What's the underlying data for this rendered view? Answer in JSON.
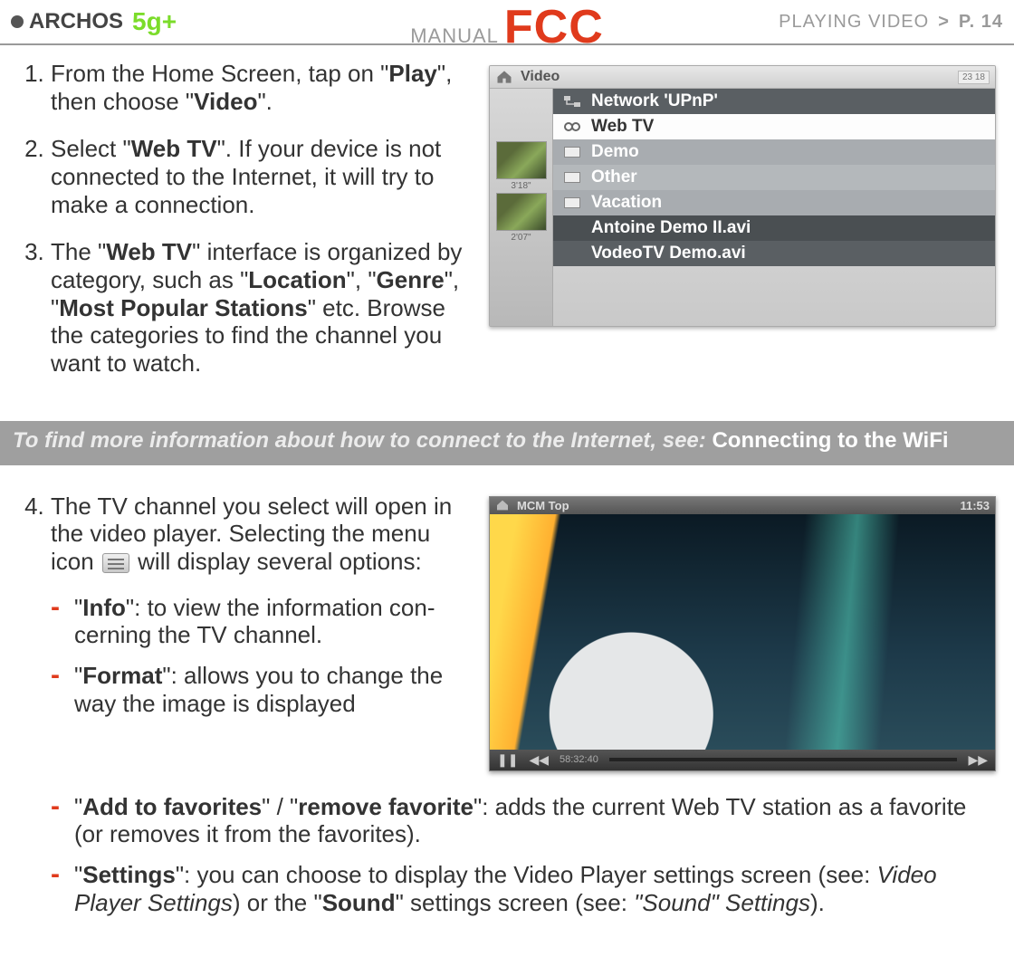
{
  "header": {
    "brand": "ARCHOS",
    "model": "5g+",
    "manual_label": "MANUAL",
    "fcc_label": "FCC",
    "crumb_section": "PLAYING VIDEO",
    "crumb_sep": ">",
    "crumb_page": "P. 14"
  },
  "steps": {
    "s1_pre": "From the Home Screen, tap on \"",
    "s1_b1": "Play",
    "s1_mid": "\", then choose \"",
    "s1_b2": "Video",
    "s1_post": "\".",
    "s2_pre": "Select \"",
    "s2_b1": "Web TV",
    "s2_post": "\". If your device is not connected to the Internet, it will try to make a connection.",
    "s3_pre": "The \"",
    "s3_b1": "Web TV",
    "s3_mid1": "\" interface is organized by cat­egory, such as \"",
    "s3_b2": "Location",
    "s3_mid2": "\", \"",
    "s3_b3": "Genre",
    "s3_mid3": "\", \"",
    "s3_b4": "Most Popular Stations",
    "s3_post": "\" etc. Browse the catego­ries to find the channel you want to watch.",
    "s4_pre": "The TV channel you select will open in the video player. Selecting the menu icon ",
    "s4_post": " will display several options:"
  },
  "callout": {
    "lead": "To find more information about how to connect to the Internet, see: ",
    "link": "Connecting to the WiFi"
  },
  "bullets": {
    "info_b": "Info",
    "info_t": ": to view the information con­cerning the TV channel.",
    "format_b": "Format",
    "format_t": ": allows you to change the way the image is displayed",
    "fav_b1": "Add to favorites",
    "fav_mid": "\" / \"",
    "fav_b2": "remove favorite",
    "fav_t": ": adds the current Web TV station as a favorite (or removes it from the favorites).",
    "set_b": "Settings",
    "set_t1": ": you can choose to display the Video Player settings screen (see: ",
    "set_i1": "Video Player Settings",
    "set_t2": ") or the \"",
    "set_b2": "Sound",
    "set_t3": "\" settings screen (see: ",
    "set_i2": "\"Sound\" Settings",
    "set_t4": ")."
  },
  "device": {
    "title": "Video",
    "status": "23 18",
    "rows": {
      "r0": "Network 'UPnP'",
      "r1": "Web TV",
      "r2": "Demo",
      "r3": "Other",
      "r4": "Vacation",
      "r5": "Antoine Demo II.avi",
      "r5d": "3'18\"",
      "r6": "VodeoTV Demo.avi",
      "r6d": "2'07\""
    }
  },
  "player": {
    "title": "MCM Top",
    "clock": "11:53",
    "time": "58:32:40"
  }
}
